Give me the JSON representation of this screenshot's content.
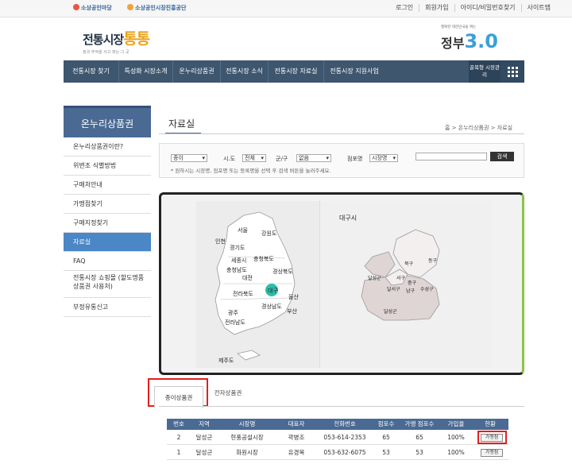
{
  "topbar": {
    "logo1": "소상공인마당",
    "logo2": "소상공인시장진흥공단",
    "links": [
      "로그인",
      "회원가입",
      "아이디/비밀번호찾기",
      "사이트맵"
    ]
  },
  "brand": {
    "title_a": "전통시장",
    "title_b": "통통",
    "tagline": "정과 추억을 사고 파는 그 곳"
  },
  "gov": {
    "small": "행복한 대한민국을 여는",
    "big_a": "정부",
    "big_b": "3.0"
  },
  "nav": {
    "items": [
      "전통시장 찾기",
      "특성화 시장소개",
      "온누리상품권",
      "전통시장 소식",
      "전통시장 자료실",
      "전통시장 지원사업"
    ],
    "side": "골목형 시장관리"
  },
  "sidebar": {
    "title": "온누리상품권",
    "items": [
      {
        "label": "온누리상품권이란?"
      },
      {
        "label": "위변조 식별방법"
      },
      {
        "label": "구매처안내"
      },
      {
        "label": "가맹점찾기"
      },
      {
        "label": "구매지정찾기"
      },
      {
        "label": "자료실",
        "active": true
      },
      {
        "label": "FAQ"
      },
      {
        "label": "전통시장 쇼핑몰 (할도명품 상품권 사용처)"
      },
      {
        "label": "부정유통신고"
      }
    ]
  },
  "content": {
    "title": "자료실",
    "breadcrumb": "홈 > 온누리상품권 > 자료실"
  },
  "search": {
    "type_value": "종이",
    "sido_label": "시.도",
    "sido_value": "전체",
    "gungu_label": "군/구",
    "gungu_value": "없음",
    "store_label": "점포명",
    "store_value": "시장명",
    "button": "검색",
    "note": "* 원하시는 시장명, 점포명 또는 등록명을 선택 후 검색 버튼을 눌러주세요."
  },
  "map": {
    "korea_labels": [
      "서울",
      "인천",
      "경기도",
      "강원도",
      "세종시",
      "충청북도",
      "충청남도",
      "대전",
      "경상북도",
      "전라북도",
      "대구",
      "울산",
      "광주",
      "경상남도",
      "부산",
      "전라남도",
      "제주도"
    ],
    "daegu_title": "대구시",
    "daegu_labels": [
      "북구",
      "동구",
      "달성군",
      "서구",
      "중구",
      "수성구",
      "달서구",
      "남구",
      "달성군"
    ]
  },
  "tabs": {
    "paper": "종이상품권",
    "electronic": "전자상품권"
  },
  "table": {
    "headers": [
      "번호",
      "지역",
      "시장명",
      "대표자",
      "전화번호",
      "점포수",
      "가맹 점포수",
      "가입율",
      "현황"
    ],
    "rows": [
      [
        "2",
        "달성군",
        "현풍공설시장",
        "곽병조",
        "053-614-2353",
        "65",
        "65",
        "100%",
        "가맹점"
      ],
      [
        "1",
        "달성군",
        "화원시장",
        "유경목",
        "053-632-6075",
        "53",
        "53",
        "100%",
        "가맹점"
      ]
    ]
  },
  "colors": {
    "nav": "#3e566e",
    "sidebar_title": "#4a6a93",
    "active": "#4b86c6",
    "highlight": "#e02020",
    "map_border_right": "#8bc34a"
  }
}
